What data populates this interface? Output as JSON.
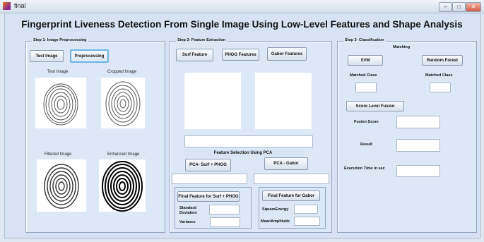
{
  "window": {
    "title": "final",
    "controls": [
      "–",
      "□",
      "✕"
    ]
  },
  "header": {
    "title": "Fingerprint Liveness Detection From Single Image Using Low-Level Features and Shape Analysis"
  },
  "step1": {
    "legend": "Step 1- Image Preprocessing",
    "test_image_button": "Test Image",
    "preprocessing_button": "Preprocessing",
    "test_image_label": "Test Image",
    "cropped_image_label": "Cropped Image",
    "filtered_image_label": "Filtered Image",
    "enhanced_image_label": "Enhanced Image"
  },
  "step2": {
    "legend": "Step 2- Feature Extraction",
    "surf_button": "Surf Feature",
    "phog_button": "PHOG Features",
    "gabor_button": "Gabor Features",
    "pca_caption": "Feature Selection Using PCA",
    "pca_surf_phog_button": "PCA- Surf + PHOG",
    "pca_gabor_button": "PCA - Gabor",
    "final_surf_phog_button": "Final Feature for Surf + PHOG",
    "final_gabor_button": "Final Feature for Gabor",
    "std_dev_label": "Standard Deviation",
    "variance_label": "Variance",
    "square_energy_label": "SquareEnergy",
    "mean_amplitude_label": "MeanAmplitude"
  },
  "step3": {
    "legend": "Step 3- Classification",
    "matching_label": "Matching",
    "svm_button": "SVM",
    "random_forest_button": "Random Forest",
    "matched_class_label_1": "Matched Class",
    "matched_class_label_2": "Matched Class",
    "score_fusion_button": "Score Level Fusion",
    "fusion_score_label": "Fusion Score",
    "result_label": "Result",
    "execution_time_label": "Execution Time in sec"
  },
  "icons": [
    "matlab-figure-icon",
    "minimize-icon",
    "maximize-icon",
    "close-icon"
  ],
  "colors": {
    "window_bg": "#d7e3f4",
    "panel_bg": "#dde8f6",
    "active_button_border": "#6fb4e6"
  }
}
